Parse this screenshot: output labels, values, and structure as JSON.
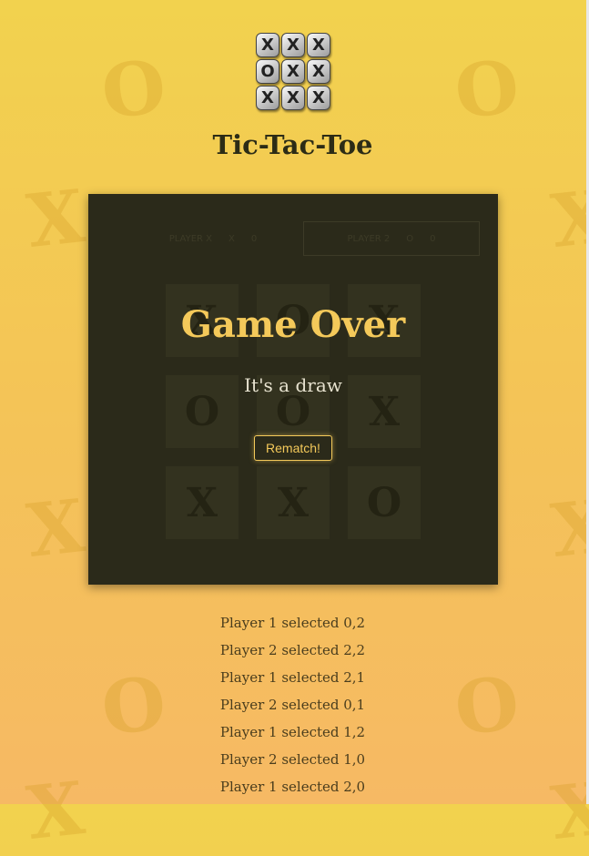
{
  "app": {
    "title": "Tic-Tac-Toe",
    "logo_tiles": [
      "X",
      "X",
      "X",
      "O",
      "X",
      "X",
      "X",
      "X",
      "X"
    ]
  },
  "scoreboard": {
    "player1": {
      "label": "PLAYER X",
      "mark": "X",
      "score": "0"
    },
    "player2": {
      "label": "PLAYER 2",
      "mark": "O",
      "score": "0"
    }
  },
  "board": {
    "cells": [
      "X",
      "O",
      "X",
      "O",
      "O",
      "X",
      "X",
      "X",
      "O"
    ]
  },
  "overlay": {
    "heading": "Game Over",
    "result": "It's a draw",
    "rematch_label": "Rematch!"
  },
  "move_log": [
    "Player 1 selected 0,2",
    "Player 2 selected 2,2",
    "Player 1 selected 2,1",
    "Player 2 selected 0,1",
    "Player 1 selected 1,2",
    "Player 2 selected 1,0",
    "Player 1 selected 2,0"
  ],
  "colors": {
    "accent": "#f4c95a",
    "board_bg": "#2b2a1a",
    "page_gradient_top": "#f2d24e",
    "page_gradient_bottom": "#f6b964"
  }
}
